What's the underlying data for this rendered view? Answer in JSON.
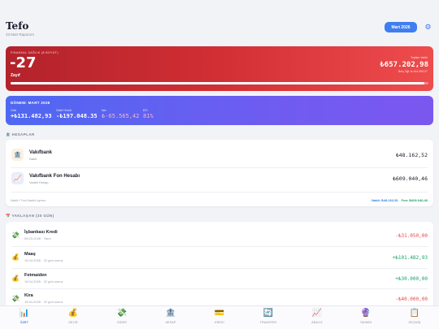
{
  "header": {
    "title": "Tefo",
    "subtitle": "23 Mart Raporum",
    "month_label": "Mart 2026",
    "settings_icon": "gear-icon"
  },
  "health": {
    "label": "FİNANSAL SAĞLIK (8 BOYUT)",
    "score": "-27",
    "status": "Zayıf",
    "net_worth_label": "Toplam Varlık",
    "net_worth": "₺657.202,98",
    "net_worth_sub": "Borç Sğl: ₺-444.506,07",
    "progress": 0.99
  },
  "period": {
    "label": "DÖNEM: MART 2026",
    "columns": [
      {
        "key": "Gelir",
        "value": "+₺131.482,93"
      },
      {
        "key": "Gider+Kredi",
        "value": "-₺197.048.35"
      },
      {
        "key": "Net",
        "value": "₺-65.565,42"
      },
      {
        "key": "BTI",
        "value": "81%"
      }
    ]
  },
  "accounts": {
    "section_label": "HESAPLAR",
    "items": [
      {
        "name": "Vakıfbank",
        "type": "Nakit",
        "amount": "₺48.162,52",
        "icon": "bank-icon"
      },
      {
        "name": "Vakıfbank Fon Hesabı",
        "type": "Vadeli Hesap",
        "amount": "₺609.040,46",
        "icon": "chart-icon"
      }
    ],
    "footer_left": "Nakit / Fon/Vadeli ayrımı",
    "footer_cash": "Nakit: ₺48.162,52",
    "footer_fund": "Fon: ₺609.040,46"
  },
  "upcoming": {
    "section_label": "YAKLAŞAN (30 GÜN)",
    "items": [
      {
        "name": "İşbankası Kredi",
        "date": "05.03.2026 · Yarın",
        "amount": "-₺31.050,00",
        "sign": "neg",
        "icon": "money-icon"
      },
      {
        "name": "Maaş",
        "date": "15.04.2026 · 22 gün sonra",
        "amount": "+₺101.482,93",
        "sign": "pos",
        "icon": "money-bag-icon"
      },
      {
        "name": "Fetmaiden",
        "date": "15.04.2026 · 22 gün sonra",
        "amount": "+₺30.000,00",
        "sign": "pos",
        "icon": "money-bag-icon"
      },
      {
        "name": "Kira",
        "date": "15.04.2026 · 22 gün sonra",
        "amount": "-₺40.000,00",
        "sign": "neg",
        "icon": "money-icon"
      }
    ]
  },
  "nav": [
    {
      "label": "ÖZET",
      "glyph": "📊",
      "icon": "summary-icon",
      "active": true
    },
    {
      "label": "GELİR",
      "glyph": "💰",
      "icon": "income-icon"
    },
    {
      "label": "GİDER",
      "glyph": "💸",
      "icon": "expense-icon"
    },
    {
      "label": "HESAP",
      "glyph": "🏦",
      "icon": "account-icon"
    },
    {
      "label": "KREDİ",
      "glyph": "💳",
      "icon": "credit-icon"
    },
    {
      "label": "TRANSFER",
      "glyph": "🔄",
      "icon": "transfer-icon"
    },
    {
      "label": "ANALİZ",
      "glyph": "📈",
      "icon": "analysis-icon"
    },
    {
      "label": "TAHMİN",
      "glyph": "🔮",
      "icon": "forecast-icon"
    },
    {
      "label": "GEÇMİŞ",
      "glyph": "📋",
      "icon": "history-icon"
    }
  ]
}
